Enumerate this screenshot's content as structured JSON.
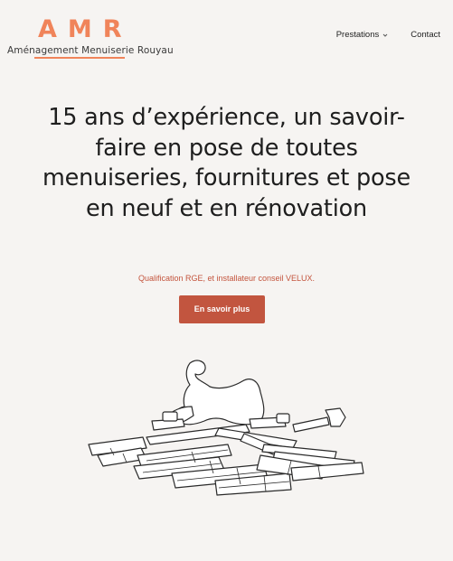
{
  "header": {
    "logo": {
      "letters": "AMR",
      "name": "Aménagement Menuiserie Rouyau",
      "accent_color": "#f0845a"
    },
    "nav": {
      "items": [
        {
          "label": "Prestations",
          "has_dropdown": true,
          "icon": "chevron-down-icon"
        },
        {
          "label": "Contact",
          "has_dropdown": false
        }
      ]
    }
  },
  "hero": {
    "title": "15 ans d’expérience, un savoir-faire en pose de toutes menuiseries, fournitures et pose en neuf et en rénovation",
    "subtitle": "Qualification RGE, et installateur conseil VELUX.",
    "cta_label": "En savoir plus",
    "cta_color": "#c2553f",
    "illustration": "carpenter-working-with-wood-planks-and-tools"
  },
  "colors": {
    "background": "#f6f4f2",
    "text": "#1e1e1e",
    "accent": "#c4553e"
  }
}
